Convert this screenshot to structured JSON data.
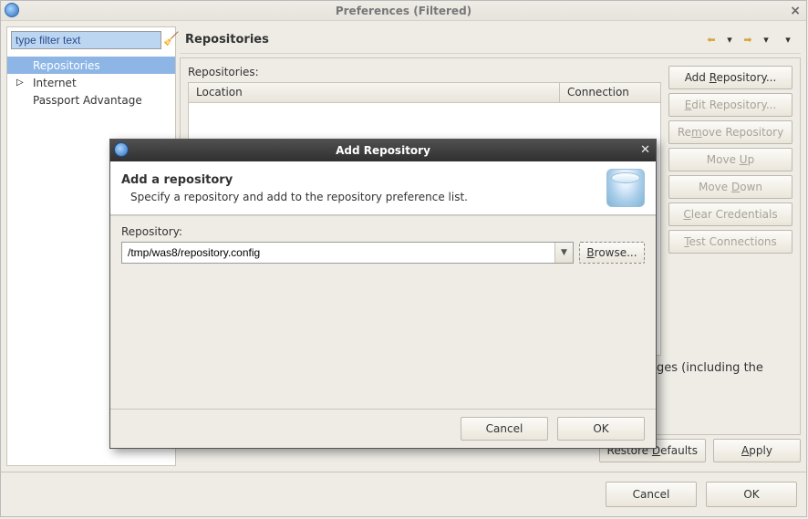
{
  "window": {
    "title": "Preferences (Filtered)"
  },
  "sidebar": {
    "filter_placeholder": "type filter text",
    "filter_value": "type filter text",
    "items": [
      {
        "label": "Repositories",
        "selected": true,
        "expandable": false
      },
      {
        "label": "Internet",
        "selected": false,
        "expandable": true
      },
      {
        "label": "Passport Advantage",
        "selected": false,
        "expandable": false
      }
    ]
  },
  "panel": {
    "title": "Repositories",
    "list_label": "Repositories:",
    "columns": {
      "location": "Location",
      "connection": "Connection"
    },
    "truncated_text_fragment": "ges (including the",
    "restore_label": "Restore Defaults",
    "apply_label": "Apply",
    "restore_suffix": "faults"
  },
  "buttons": {
    "add": "Add Repository...",
    "edit": "Edit Repository...",
    "remove": "Remove Repository",
    "moveup": "Move Up",
    "movedown": "Move Down",
    "clearcred": "Clear Credentials",
    "testconn": "Test Connections"
  },
  "main_buttons": {
    "cancel": "Cancel",
    "ok": "OK"
  },
  "dialog": {
    "title": "Add Repository",
    "heading": "Add a repository",
    "sub": "Specify a repository and add to the repository preference list.",
    "field_label": "Repository:",
    "field_value": "/tmp/was8/repository.config",
    "browse": "Browse...",
    "cancel": "Cancel",
    "ok": "OK"
  }
}
